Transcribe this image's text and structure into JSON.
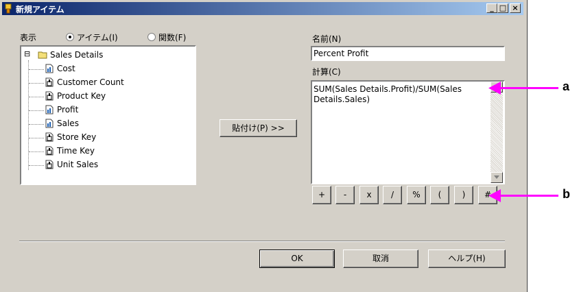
{
  "window": {
    "title": "新規アイテム",
    "minimize_glyph": "_",
    "maximize_glyph": "□",
    "close_glyph": "×"
  },
  "view": {
    "label": "表示",
    "radio_items_label": "アイテム(I)",
    "radio_functions_label": "関数(F)",
    "selected": "items"
  },
  "tree": {
    "root_toggle": "⊟",
    "root": "Sales Details",
    "items": [
      {
        "label": "Cost",
        "icon": "measure-icon"
      },
      {
        "label": "Customer Count",
        "icon": "dimension-icon"
      },
      {
        "label": "Product Key",
        "icon": "dimension-icon"
      },
      {
        "label": "Profit",
        "icon": "measure-icon"
      },
      {
        "label": "Sales",
        "icon": "measure-icon"
      },
      {
        "label": "Store Key",
        "icon": "dimension-icon"
      },
      {
        "label": "Time Key",
        "icon": "dimension-icon"
      },
      {
        "label": "Unit Sales",
        "icon": "dimension-icon"
      }
    ]
  },
  "paste_button": "貼付け(P) >>",
  "name": {
    "label": "名前(N)",
    "value": "Percent Profit"
  },
  "calc": {
    "label": "計算(C)",
    "value": "SUM(Sales Details.Profit)/SUM(Sales Details.Sales)"
  },
  "operators": [
    "+",
    "-",
    "x",
    "/",
    "%",
    "(",
    ")",
    "#"
  ],
  "buttons": {
    "ok": "OK",
    "cancel": "取消",
    "help": "ヘルプ(H)"
  },
  "callouts": {
    "a": "a",
    "b": "b",
    "color": "#ff00ff"
  }
}
